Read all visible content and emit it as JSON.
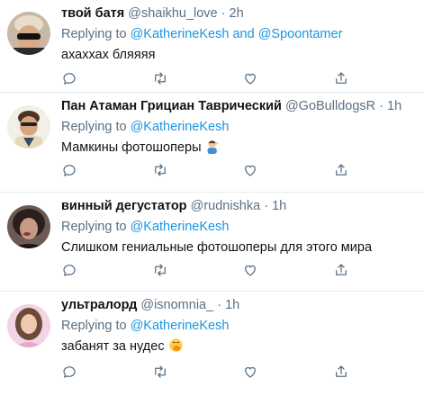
{
  "replying_prefix": "Replying to",
  "tweets": [
    {
      "name": "твой батя",
      "handle": "@shaikhu_love",
      "dot": "·",
      "time": "2h",
      "mentions": [
        "@KatherineKesh",
        "@Spoontamer"
      ],
      "mention_joiner": "and",
      "text": "ахаххах бляяяя",
      "emoji": ""
    },
    {
      "name": "Пан Атаман Грициан Таврический",
      "handle": "@GoBulldogsR",
      "dot": "·",
      "time": "1h",
      "mentions": [
        "@KatherineKesh"
      ],
      "text": "Мамкины фотошоперы",
      "emoji": "man-facepalming"
    },
    {
      "name": "винный дегустатор",
      "handle": "@rudnishka",
      "dot": "·",
      "time": "1h",
      "mentions": [
        "@KatherineKesh"
      ],
      "text": "Слишком гениальные фотошоперы для этого мира",
      "emoji": ""
    },
    {
      "name": "ультралорд",
      "handle": "@isnomnia_",
      "dot": "·",
      "time": "1h",
      "mentions": [
        "@KatherineKesh"
      ],
      "text": "забанят за нудес",
      "emoji": "face-with-hand-over-mouth"
    }
  ],
  "colors": {
    "text": "#0f1419",
    "secondary": "#5b7083",
    "link": "#1b95e0",
    "divider": "#e6ecf0"
  }
}
